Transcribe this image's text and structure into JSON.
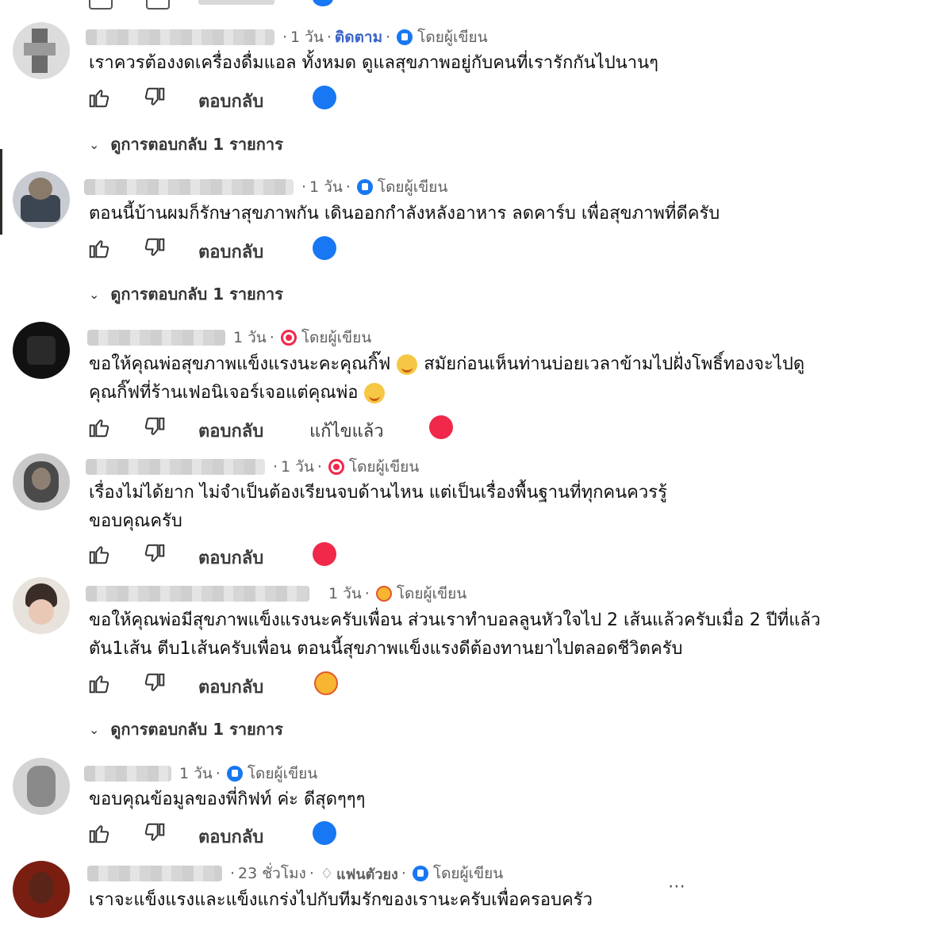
{
  "ui": {
    "reply_label": "ตอบกลับ",
    "edited_label": "แก้ไขแล้ว",
    "by_author": "โดยผู้เขียน",
    "follow_label": "ติดตาม",
    "fan_label": "แฟนตัวยง",
    "more_icon": "⋯"
  },
  "comments": [
    {
      "time": "1 วัน",
      "text": [
        "เราควรต้องงดเครื่องดื่มแอล ทั้งหมด ดูแลสุขภาพอยู่กับคนที่เรารักกันไปนานๆ"
      ],
      "reaction": "like",
      "replies": "ดูการตอบกลับ 1 รายการ"
    },
    {
      "time": "1 วัน",
      "text": [
        "ตอนนี้บ้านผมก็รักษาสุขภาพกัน เดินออกกำลังหลังอาหาร ลดคาร์บ เพื่อสุขภาพที่ดีครับ"
      ],
      "reaction": "like",
      "replies": "ดูการตอบกลับ 1 รายการ"
    },
    {
      "time": "1 วัน",
      "text": [
        "ขอให้คุณพ่อสุขภาพแข็งแรงนะคะคุณกิ๊ฟ",
        "สมัยก่อนเห็นท่านบ่อยเวลาข้ามไปฝั่งโพธิ์ทองจะไปดู",
        "คุณกิ๊ฟที่ร้านเฟอนิเจอร์เจอแต่คุณพ่อ"
      ],
      "reaction": "love"
    },
    {
      "time": "1 วัน",
      "text": [
        "เรื่องไม่ได้ยาก ไม่จำเป็นต้องเรียนจบด้านไหน แต่เป็นเรื่องพื้นฐานที่ทุกคนควรรู้",
        "ขอบคุณครับ"
      ],
      "reaction": "love"
    },
    {
      "time": "1 วัน",
      "text": [
        "ขอให้คุณพ่อมีสุขภาพแข็งแรงนะครับเพื่อน ส่วนเราทำบอลลูนหัวใจไป 2 เส้นแล้วครับเมื่อ 2 ปีที่แล้ว",
        "ตัน1เส้น ตีบ1เส้นครับเพื่อน ตอนนี้สุขภาพแข็งแรงดีต้องทานยาไปตลอดชีวิตครับ"
      ],
      "reaction": "care",
      "replies": "ดูการตอบกลับ 1 รายการ"
    },
    {
      "time": "1 วัน",
      "text": [
        "ขอบคุณข้อมูลของพี่กิฟท์ ค่ะ ดีสุดๆๆๆ"
      ],
      "reaction": "like"
    },
    {
      "time": "23 ชั่วโมง",
      "text": [
        "เราจะแข็งแรงและแข็งแกร่งไปกับทีมรักของเรานะครับเพื่อครอบครัว"
      ]
    }
  ]
}
